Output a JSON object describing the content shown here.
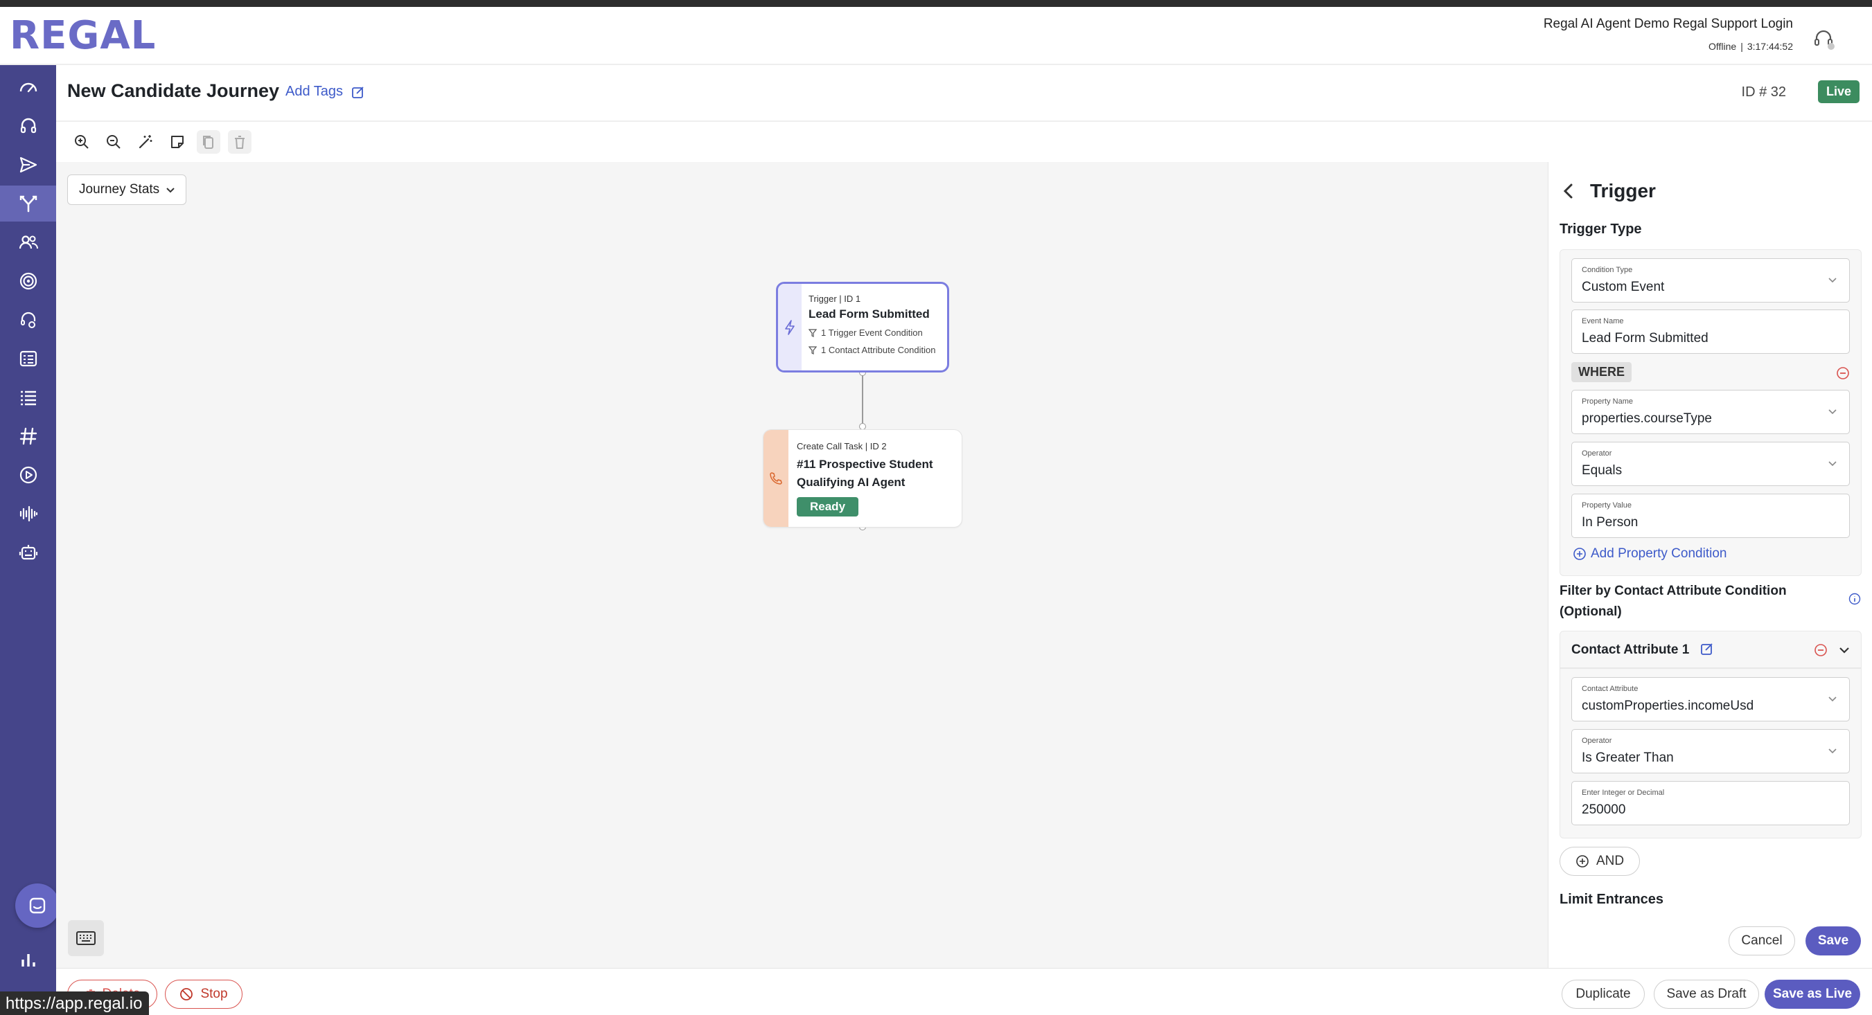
{
  "brand": {
    "logo": "REGAL"
  },
  "header": {
    "user_line": "Regal AI Agent Demo Regal Support Login",
    "status": "Offline",
    "timer": "3:17:44:52",
    "status_icon": "headset-icon"
  },
  "sidebar": {
    "items": [
      {
        "icon": "speedometer-icon"
      },
      {
        "icon": "headset-icon"
      },
      {
        "icon": "send-icon"
      },
      {
        "icon": "journey-branch-icon",
        "active": true
      },
      {
        "icon": "contacts-icon"
      },
      {
        "icon": "target-icon"
      },
      {
        "icon": "agent-support-icon"
      },
      {
        "icon": "reports-icon"
      },
      {
        "icon": "list-icon"
      },
      {
        "icon": "hashtag-icon"
      },
      {
        "icon": "play-circle-icon"
      },
      {
        "icon": "audio-wave-icon"
      },
      {
        "icon": "robot-icon"
      }
    ],
    "bottom_icon": "bar-chart-icon",
    "accent": "#45458a",
    "active_bg": "#6566b4"
  },
  "journey": {
    "title": "New Candidate Journey",
    "add_tags": "Add Tags",
    "id_label": "ID # 32",
    "status": "Live",
    "status_color": "#3c8c5f"
  },
  "toolbar": {
    "tools": [
      "zoom-in-icon",
      "zoom-out-icon",
      "magic-wand-icon",
      "sticky-note-icon",
      "copy-icon",
      "trash-icon"
    ]
  },
  "canvas": {
    "stats_dropdown": "Journey Stats",
    "nodes": [
      {
        "header": "Trigger | ID 1",
        "title": "Lead Form Submitted",
        "conditions": [
          "1 Trigger Event Condition",
          "1 Contact Attribute Condition"
        ]
      },
      {
        "header": "Create Call Task | ID 2",
        "title": "#11 Prospective Student Qualifying AI Agent",
        "badge": "Ready"
      }
    ]
  },
  "panel": {
    "title": "Trigger",
    "trigger_type_label": "Trigger Type",
    "condition_type": {
      "label": "Condition Type",
      "value": "Custom Event"
    },
    "event_name": {
      "label": "Event Name",
      "value": "Lead Form Submitted"
    },
    "where": "WHERE",
    "property_name": {
      "label": "Property Name",
      "value": "properties.courseType"
    },
    "operator1": {
      "label": "Operator",
      "value": "Equals"
    },
    "property_value": {
      "label": "Property Value",
      "value": "In Person"
    },
    "add_property": "Add Property Condition",
    "filter_label": "Filter by Contact Attribute Condition (Optional)",
    "contact_attr_title": "Contact Attribute 1",
    "contact_attribute": {
      "label": "Contact Attribute",
      "value": "customProperties.incomeUsd"
    },
    "operator2": {
      "label": "Operator",
      "value": "Is Greater Than"
    },
    "number_value": {
      "label": "Enter Integer or Decimal",
      "value": "250000"
    },
    "and_label": "AND",
    "limit_label": "Limit Entrances",
    "cancel": "Cancel",
    "save": "Save"
  },
  "bottom": {
    "delete": "Delete",
    "stop": "Stop",
    "duplicate": "Duplicate",
    "save_draft": "Save as Draft",
    "save_live": "Save as Live"
  },
  "url_tooltip": "https://app.regal.io"
}
